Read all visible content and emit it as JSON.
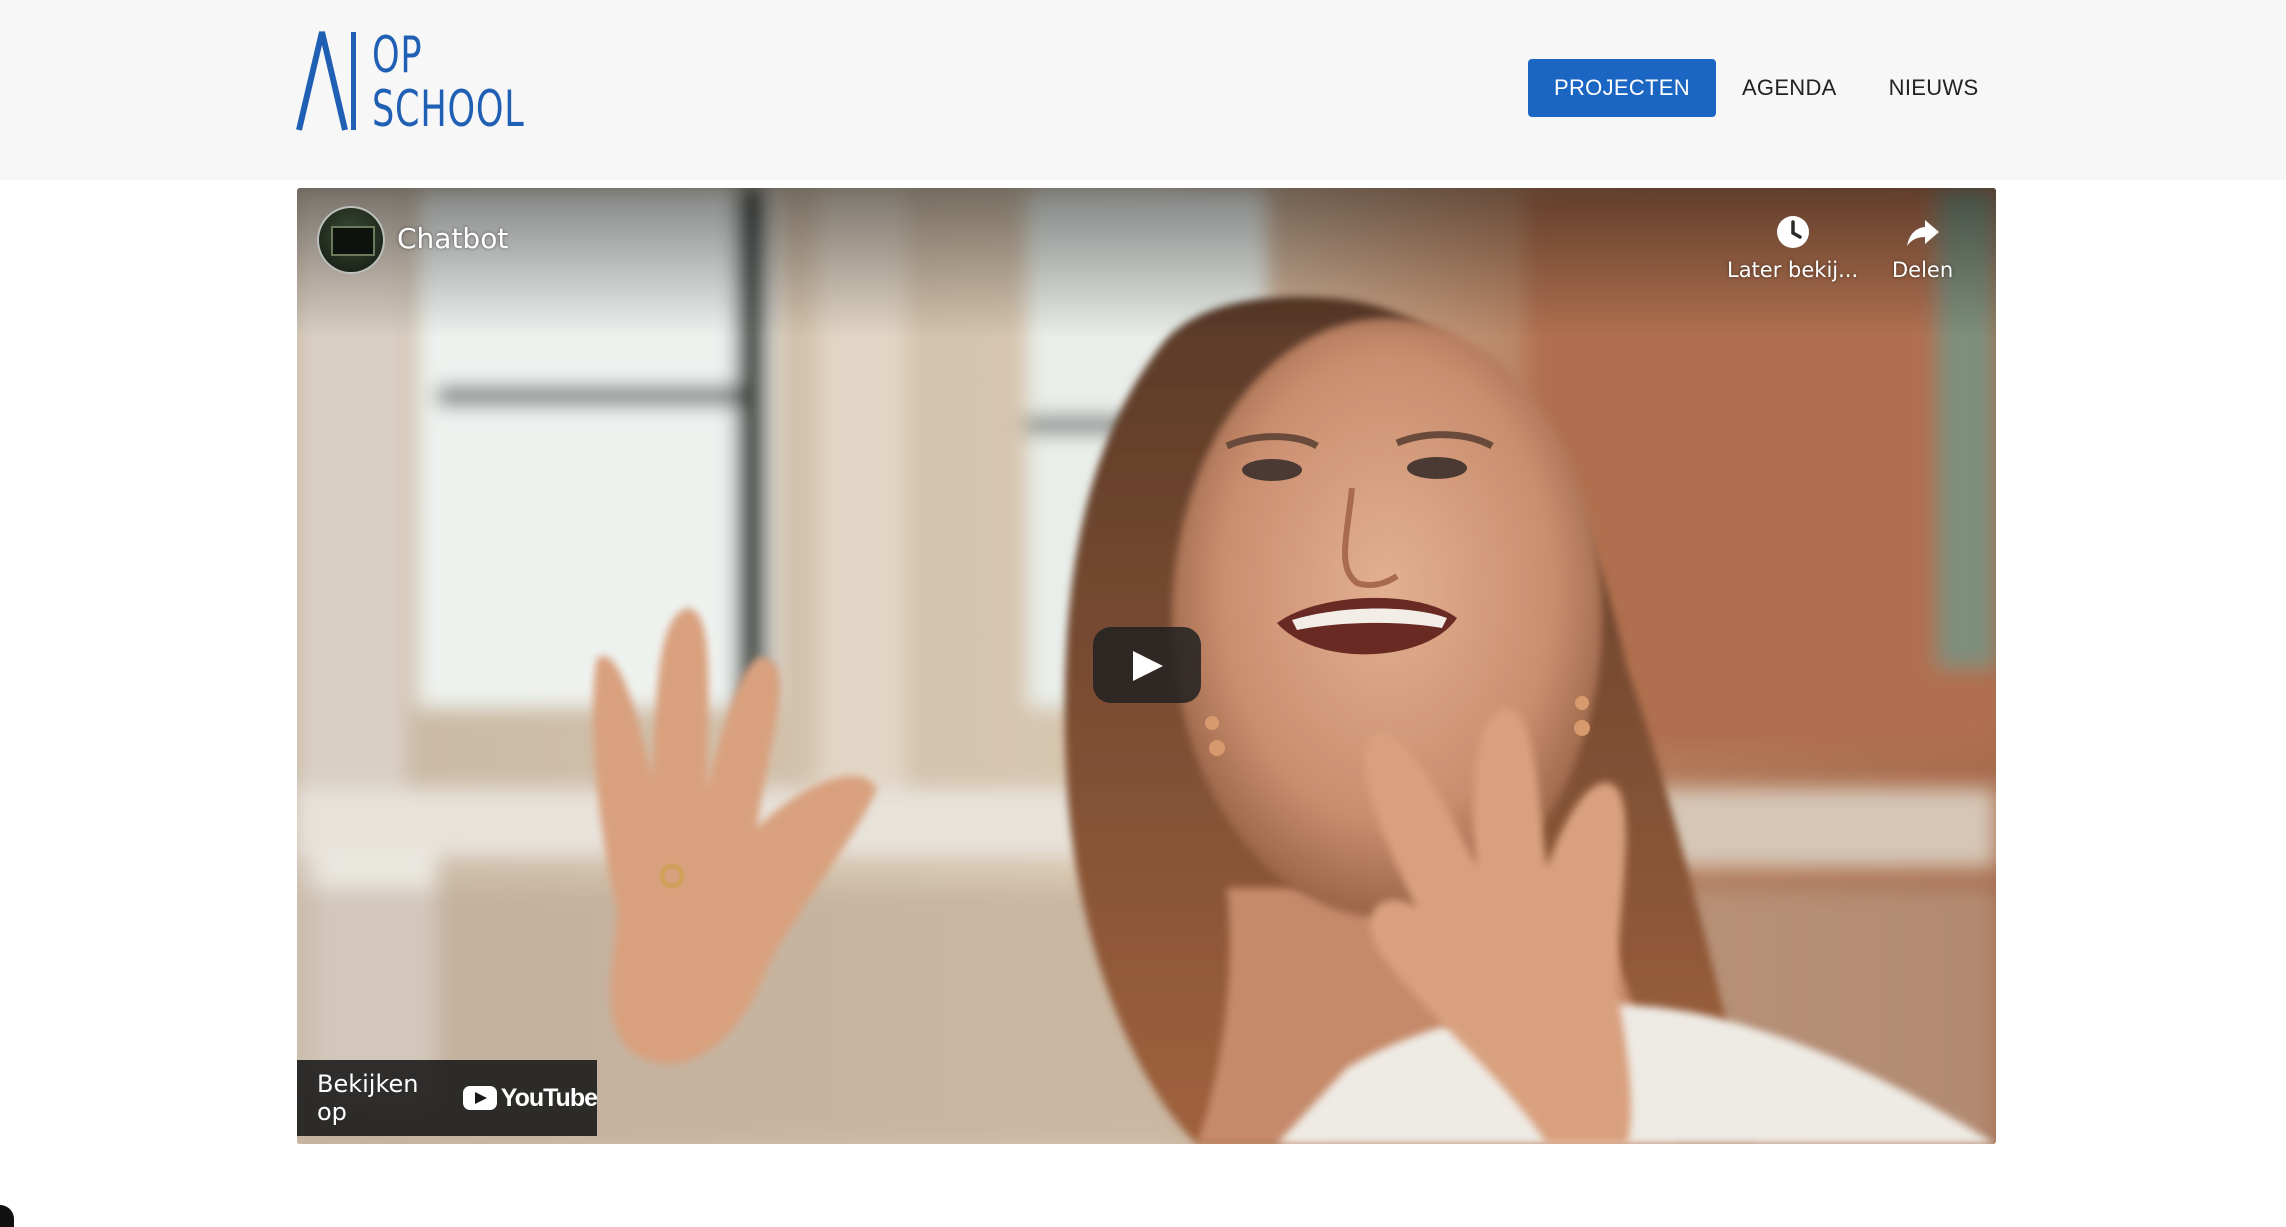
{
  "site": {
    "logo": {
      "mark": "AI",
      "line1": "OP",
      "line2": "SCHOOL",
      "color": "#1f5fb4"
    }
  },
  "nav": {
    "items": [
      {
        "label": "PROJECTEN",
        "active": true
      },
      {
        "label": "AGENDA",
        "active": false
      },
      {
        "label": "NIEUWS",
        "active": false
      }
    ],
    "active_color": "#1c66c3"
  },
  "video": {
    "title": "Chatbot",
    "watch_later_label": "Later bekij...",
    "share_label": "Delen",
    "watch_on_label": "Bekijken op",
    "platform_name": "YouTube",
    "icons": {
      "channel": "channel-avatar-icon",
      "watch_later": "clock-icon",
      "share": "share-arrow-icon",
      "play": "play-icon",
      "platform": "youtube-logo-icon"
    }
  }
}
